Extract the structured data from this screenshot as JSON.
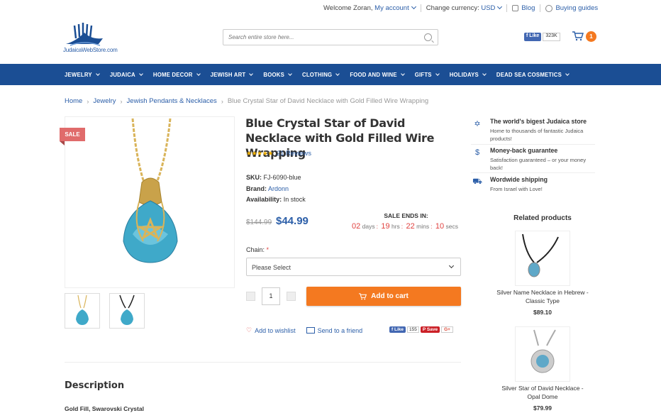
{
  "topbar": {
    "welcome": "Welcome Zoran,",
    "account": "My account",
    "currency_label": "Change currency:",
    "currency": "USD",
    "blog": "Blog",
    "guides": "Buying guides"
  },
  "header": {
    "logo_text": "JudaicaWebStore.com",
    "search_placeholder": "Search entire store here...",
    "fb_like": "Like",
    "fb_count": "323K",
    "cart_count": "1"
  },
  "nav": {
    "items": [
      "JEWELRY",
      "JUDAICA",
      "HOME DECOR",
      "JEWISH ART",
      "BOOKS",
      "CLOTHING",
      "FOOD AND WINE",
      "GIFTS",
      "HOLIDAYS",
      "DEAD SEA COSMETICS"
    ]
  },
  "breadcrumb": {
    "items": [
      "Home",
      "Jewelry",
      "Jewish Pendants & Necklaces"
    ],
    "current": "Blue Crystal Star of David Necklace with Gold Filled Wire Wrapping"
  },
  "product": {
    "sale_badge": "SALE",
    "title": "Blue Crystal Star of David Necklace with Gold Filled Wire Wrapping",
    "stars": "★★★★★",
    "rating": 5,
    "reviews": "21 Reviews",
    "sku_label": "SKU:",
    "sku": "FJ-6090-blue",
    "brand_label": "Brand:",
    "brand": "Ardonn",
    "availability_label": "Availability:",
    "availability": "In stock",
    "old_price": "$144.99",
    "price": "$44.99",
    "sale_ends": "SALE ENDS IN:",
    "countdown": {
      "days": "02",
      "days_label": "days",
      "hrs": "19",
      "hrs_label": "hrs",
      "mins": "22",
      "mins_label": "mins",
      "secs": "10",
      "secs_label": "secs"
    },
    "chain_label": "Chain:",
    "chain_required": "*",
    "chain_value": "Please Select",
    "qty": "1",
    "add_to_cart": "Add to cart",
    "wishlist": "Add to wishlist",
    "send_friend": "Send to a friend",
    "fb_like": "Like",
    "fb_count": "155",
    "pin_save": "Save",
    "gplus": "G+"
  },
  "description": {
    "heading": "Description",
    "subheading": "Gold Fill, Swarovski Crystal"
  },
  "perks": [
    {
      "icon": "star-of-david-icon",
      "title": "The world's bigest Judaica store",
      "desc": "Home to thousands of fantastic Judaica products!"
    },
    {
      "icon": "dollar-icon",
      "title": "Money-back guarantee",
      "desc": "Satisfaction guaranteed – or your money back!"
    },
    {
      "icon": "truck-icon",
      "title": "Wordwide shipping",
      "desc": "From Israel with Love!"
    }
  ],
  "related": {
    "heading": "Related products",
    "items": [
      {
        "name": "Silver Name Necklace in Hebrew - Classic Type",
        "price": "$89.10"
      },
      {
        "name": "Silver Star of David Necklace - Opal Dome",
        "price": "$79.99"
      }
    ]
  },
  "colors": {
    "nav": "#1b4e94",
    "accent": "#f47920",
    "link": "#2b5ea8",
    "sale": "#e06b6b"
  }
}
